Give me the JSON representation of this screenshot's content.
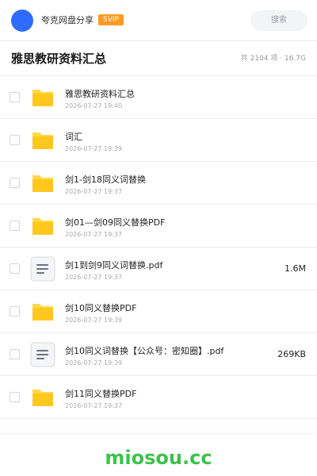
{
  "header": {
    "user_name": "夸克网盘分享",
    "badge": "SVIP",
    "search_label": "搜索"
  },
  "title_bar": {
    "title": "雅思教研资料汇总",
    "summary": "共 2104 项 · 16.7G"
  },
  "files": [
    {
      "name": "雅思教研资料汇总",
      "date": "2026-07-27 19:40",
      "size": "",
      "type": "folder",
      "icon": "folder-icon"
    },
    {
      "name": "词汇",
      "date": "2026-07-27 19:39",
      "size": "",
      "type": "folder",
      "icon": "folder-icon"
    },
    {
      "name": "剑1-剑18同义词替换",
      "date": "2026-07-27 19:37",
      "size": "",
      "type": "folder",
      "icon": "folder-icon"
    },
    {
      "name": "剑01—剑09同义替换PDF",
      "date": "2026-07-27 19:37",
      "size": "",
      "type": "folder",
      "icon": "folder-icon"
    },
    {
      "name": "剑1到剑9同义词替换.pdf",
      "date": "2026-07-27 19:37",
      "size": "1.6M",
      "type": "document",
      "icon": "document-icon"
    },
    {
      "name": "剑10同义替换PDF",
      "date": "2026-07-27 19:39",
      "size": "",
      "type": "folder",
      "icon": "folder-icon"
    },
    {
      "name": "剑10同义词替换【公众号：密知圈】.pdf",
      "date": "2026-07-27 19:39",
      "size": "269KB",
      "type": "document",
      "icon": "document-icon"
    },
    {
      "name": "剑11同义替换PDF",
      "date": "2026-07-27 19:37",
      "size": "",
      "type": "folder",
      "icon": "folder-icon"
    }
  ],
  "footer": {
    "watermark": "miosou.cc"
  },
  "colors": {
    "avatar": "#2f6bff",
    "badge": "#ff9a1f",
    "folder": "#ffc81e",
    "watermark": "#3cc24a"
  }
}
